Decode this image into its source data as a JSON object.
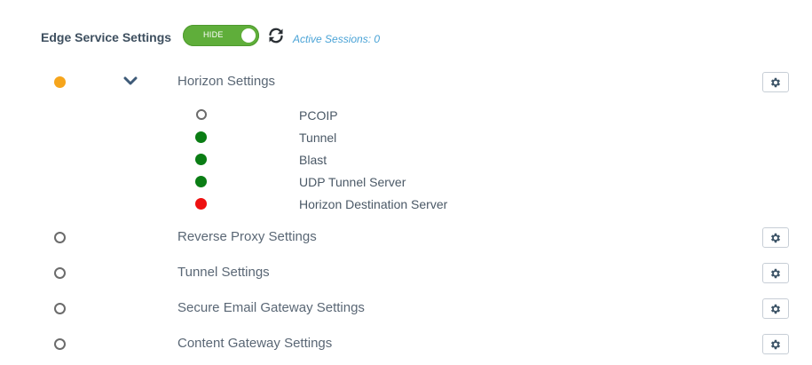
{
  "header": {
    "title": "Edge Service Settings",
    "toggle_label": "HIDE",
    "active_sessions": "Active Sessions: 0"
  },
  "colors": {
    "toggle_on": "#5fae3a",
    "status_warning": "#f6a51c",
    "status_ok": "#0a7d14",
    "status_error": "#ee1111",
    "link": "#4aa3d6"
  },
  "horizon": {
    "label": "Horizon Settings",
    "status": "warning",
    "expanded": true,
    "sub_items": [
      {
        "label": "PCOIP",
        "status": "none"
      },
      {
        "label": "Tunnel",
        "status": "ok"
      },
      {
        "label": "Blast",
        "status": "ok"
      },
      {
        "label": "UDP Tunnel Server",
        "status": "ok"
      },
      {
        "label": "Horizon Destination Server",
        "status": "error"
      }
    ]
  },
  "services": [
    {
      "label": "Reverse Proxy Settings",
      "status": "none"
    },
    {
      "label": "Tunnel Settings",
      "status": "none"
    },
    {
      "label": "Secure Email Gateway Settings",
      "status": "none"
    },
    {
      "label": "Content Gateway Settings",
      "status": "none"
    }
  ],
  "icons": {
    "refresh": "refresh-icon",
    "chevron": "chevron-down-icon",
    "gear": "gear-icon"
  }
}
